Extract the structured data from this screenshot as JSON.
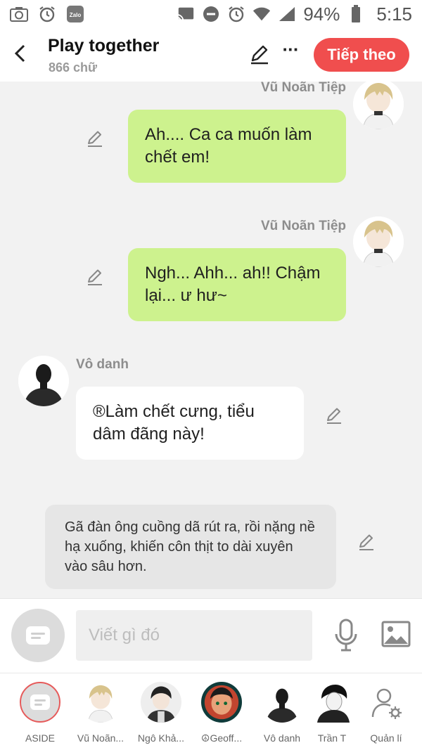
{
  "status_bar": {
    "battery": "94%",
    "time": "5:15",
    "left_icons": [
      "screenshot-icon",
      "alarm-icon",
      "zalo-icon"
    ],
    "right_icons": [
      "cast-icon",
      "do-not-disturb-icon",
      "alarm-icon",
      "wifi-icon",
      "signal-icon",
      "battery-icon"
    ],
    "zalo_label": "Zalo"
  },
  "header": {
    "title": "Play together",
    "word_count": "866 chữ",
    "next_button": "Tiếp theo",
    "more": "···"
  },
  "messages": [
    {
      "speaker": "Vũ Noãn Tiệp",
      "text": "Ah.... Ca ca muốn làm chết em!",
      "side": "right",
      "style": "green"
    },
    {
      "speaker": "Vũ Noãn Tiệp",
      "text": "Ngh... Ahh... ah!! Chậm lại... ư hư~",
      "side": "right",
      "style": "green"
    },
    {
      "speaker": "Vô danh",
      "text": "®Làm chết cưng, tiểu dâm đãng này!",
      "side": "left",
      "style": "white"
    },
    {
      "speaker": "",
      "text": "Gã đàn ông cuồng dã rút ra, rồi nặng nề hạ xuống, khiến côn thịt to dài xuyên vào sâu hơn.",
      "side": "narration",
      "style": "gray"
    }
  ],
  "input": {
    "placeholder": "Viết gì đó"
  },
  "characters": [
    {
      "label": "ASIDE"
    },
    {
      "label": "Vũ Noãn..."
    },
    {
      "label": "Ngô Khả..."
    },
    {
      "label": "☮Geoff..."
    },
    {
      "label": "Vô danh"
    },
    {
      "label": "Trần T"
    },
    {
      "label": "Quản lí"
    }
  ],
  "colors": {
    "accent": "#f04e4e",
    "user_bubble": "#cdf28e",
    "other_bubble": "#ffffff",
    "narration_bubble": "#e6e6e6",
    "background": "#f2f2f2"
  }
}
